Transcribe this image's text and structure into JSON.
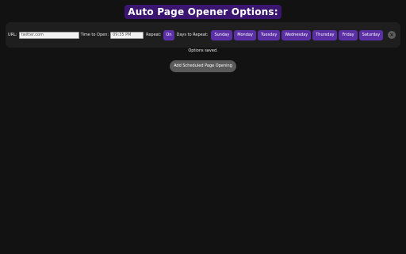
{
  "header": {
    "title": "Auto Page Opener Options:"
  },
  "schedule": {
    "url_label": "URL:",
    "url_value": "twitter.com",
    "time_label": "Time to Open:",
    "time_value": "09:35 PM",
    "repeat_label": "Repeat:",
    "repeat_button": "On",
    "days_label": "Days to Repeat:",
    "days": [
      "Sunday",
      "Monday",
      "Tuesday",
      "Wednesday",
      "Thursday",
      "Friday",
      "Saturday"
    ],
    "remove_icon": "close-icon",
    "remove_glyph": "×"
  },
  "status": {
    "message": "Options saved."
  },
  "actions": {
    "add_label": "Add Scheduled Page Opening"
  },
  "colors": {
    "background": "#121212",
    "title_bg": "#3b1670",
    "accent": "#5b30a6",
    "row_bg": "#1e1e1e",
    "add_button_bg": "#5a5a5a"
  }
}
